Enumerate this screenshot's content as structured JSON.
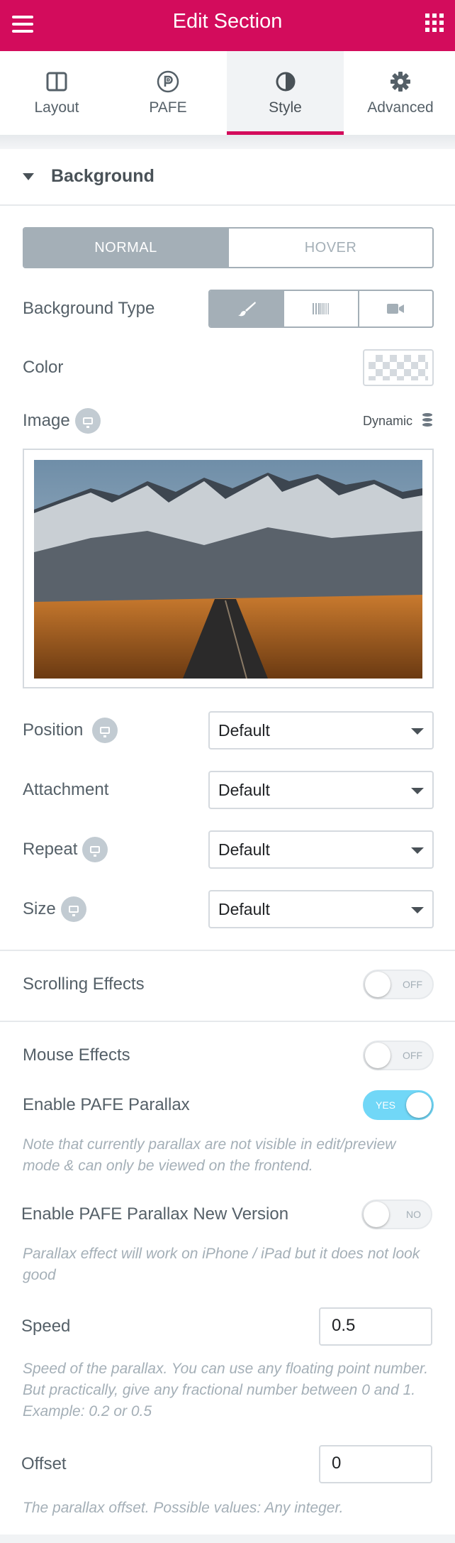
{
  "header": {
    "title": "Edit Section",
    "menu_icon": "hamburger-icon",
    "apps_icon": "grid-icon"
  },
  "tabs": [
    {
      "label": "Layout",
      "icon": "columns-icon",
      "active": false
    },
    {
      "label": "PAFE",
      "icon": "pafe-icon",
      "active": false
    },
    {
      "label": "Style",
      "icon": "contrast-icon",
      "active": true
    },
    {
      "label": "Advanced",
      "icon": "gear-icon",
      "active": false
    }
  ],
  "section": {
    "title": "Background"
  },
  "state_switch": {
    "normal": "NORMAL",
    "hover": "HOVER",
    "selected": "NORMAL"
  },
  "background_type": {
    "label": "Background Type",
    "options": [
      "brush-icon",
      "gradient-icon",
      "video-icon"
    ],
    "selected": "brush-icon"
  },
  "color": {
    "label": "Color"
  },
  "image": {
    "label": "Image",
    "dynamic_label": "Dynamic"
  },
  "position": {
    "label": "Position",
    "value": "Default"
  },
  "attachment": {
    "label": "Attachment",
    "value": "Default"
  },
  "repeat": {
    "label": "Repeat",
    "value": "Default"
  },
  "size": {
    "label": "Size",
    "value": "Default"
  },
  "scrolling_effects": {
    "label": "Scrolling Effects",
    "state": "OFF"
  },
  "mouse_effects": {
    "label": "Mouse Effects",
    "state": "OFF"
  },
  "pafe_parallax": {
    "label": "Enable PAFE Parallax",
    "state": "YES",
    "note": "Note that currently parallax are not visible in edit/preview mode & can only be viewed on the frontend."
  },
  "pafe_parallax_new": {
    "label": "Enable PAFE Parallax New Version",
    "state": "NO",
    "note": "Parallax effect will work on iPhone / iPad but it does not look good"
  },
  "speed": {
    "label": "Speed",
    "value": "0.5",
    "note": "Speed of the parallax. You can use any floating point number. But practically, give any fractional number between 0 and 1. Example: 0.2 or 0.5"
  },
  "offset": {
    "label": "Offset",
    "value": "0",
    "note": "The parallax offset. Possible values: Any integer."
  },
  "colors": {
    "accent": "#d30c5c",
    "toggle_on": "#71d7f7",
    "muted": "#a4afb7"
  }
}
